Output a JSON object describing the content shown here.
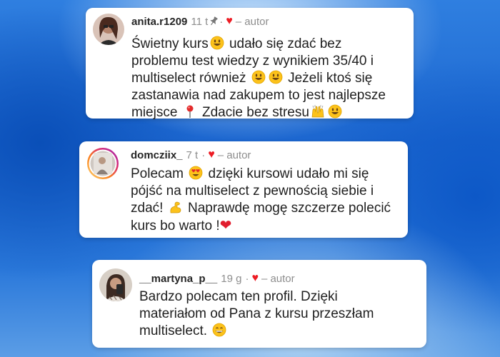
{
  "comments": [
    {
      "username": "anita.r1209",
      "time": "11 t",
      "sep": "·",
      "author_tag": "– autor",
      "lines": [
        "Świetny kurs",
        "udało się zdać bez",
        "problemu test wiedzy z wynikiem 35/40 i",
        "multiselect również",
        "Jeżeli ktoś się",
        "zastanawia nad zakupem to jest najlepsze",
        "miejsce",
        "Zdacie bez stresu"
      ]
    },
    {
      "username": "domcziix_",
      "time": "7 t",
      "sep": "·",
      "author_tag": "– autor",
      "lines": [
        "Polecam",
        "dzięki kursowi udało mi się",
        "pójść na multiselect z pewnością siebie i",
        "zdać!",
        "Naprawdę mogę szczerze polecić",
        "kurs bo warto !"
      ]
    },
    {
      "username": "__martyna_p__",
      "time": "19 g",
      "sep": "·",
      "author_tag": "– autor",
      "lines": [
        "Bardzo polecam ten profil. Dzięki",
        "materiałom od Pana z kursu przeszłam",
        "multiselect."
      ]
    }
  ],
  "icons": {
    "liked_heart": "♥",
    "heart_emoji": "❤"
  },
  "colors": {
    "background_blue": "#1c66cf",
    "like_red": "#ed1c24",
    "meta_gray": "#8e8e8e"
  }
}
